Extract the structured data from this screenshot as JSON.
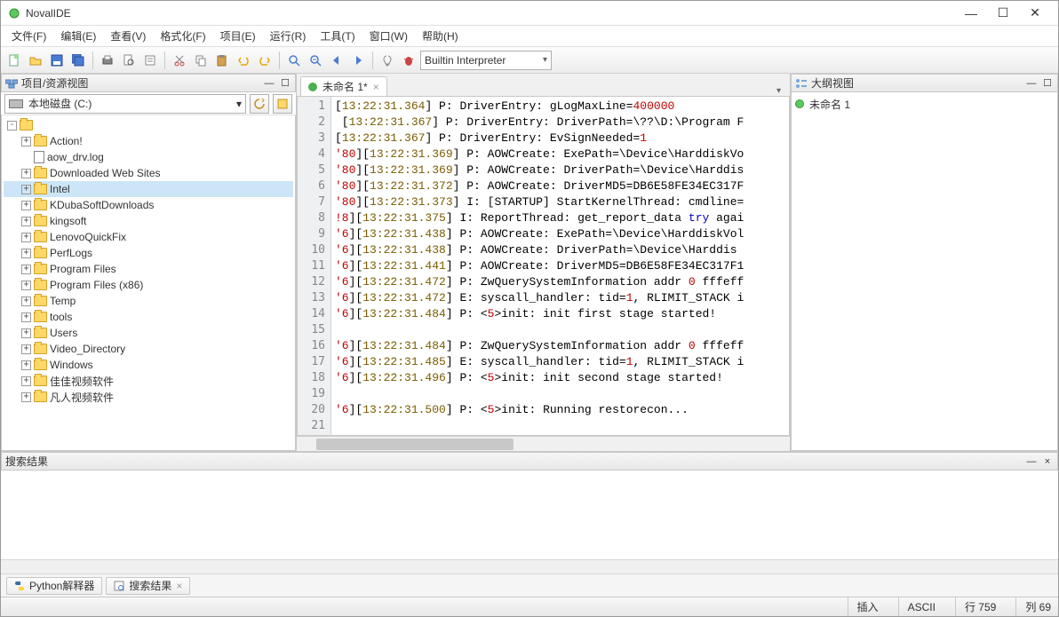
{
  "app": {
    "title": "NovalIDE"
  },
  "menu": [
    "文件(F)",
    "编辑(E)",
    "查看(V)",
    "格式化(F)",
    "项目(E)",
    "运行(R)",
    "工具(T)",
    "窗口(W)",
    "帮助(H)"
  ],
  "toolbar": {
    "interpreter": "Builtin Interpreter"
  },
  "projectPanel": {
    "title": "项目/资源视图",
    "drive": "本地磁盘 (C:)",
    "tree": [
      {
        "exp": "-",
        "ico": "folder",
        "label": ""
      },
      {
        "exp": "+",
        "ico": "folder",
        "label": "Action!",
        "lvl": 1
      },
      {
        "exp": "",
        "ico": "file",
        "label": "aow_drv.log",
        "lvl": 1
      },
      {
        "exp": "+",
        "ico": "folder",
        "label": "Downloaded Web Sites",
        "lvl": 1
      },
      {
        "exp": "+",
        "ico": "folder",
        "label": "Intel",
        "lvl": 1,
        "sel": true
      },
      {
        "exp": "+",
        "ico": "folder",
        "label": "KDubaSoftDownloads",
        "lvl": 1
      },
      {
        "exp": "+",
        "ico": "folder",
        "label": "kingsoft",
        "lvl": 1
      },
      {
        "exp": "+",
        "ico": "folder",
        "label": "LenovoQuickFix",
        "lvl": 1
      },
      {
        "exp": "+",
        "ico": "folder",
        "label": "PerfLogs",
        "lvl": 1
      },
      {
        "exp": "+",
        "ico": "folder",
        "label": "Program Files",
        "lvl": 1
      },
      {
        "exp": "+",
        "ico": "folder",
        "label": "Program Files (x86)",
        "lvl": 1
      },
      {
        "exp": "+",
        "ico": "folder",
        "label": "Temp",
        "lvl": 1
      },
      {
        "exp": "+",
        "ico": "folder",
        "label": "tools",
        "lvl": 1
      },
      {
        "exp": "+",
        "ico": "folder",
        "label": "Users",
        "lvl": 1
      },
      {
        "exp": "+",
        "ico": "folder",
        "label": "Video_Directory",
        "lvl": 1
      },
      {
        "exp": "+",
        "ico": "folder",
        "label": "Windows",
        "lvl": 1
      },
      {
        "exp": "+",
        "ico": "folder",
        "label": "佳佳视频软件",
        "lvl": 1
      },
      {
        "exp": "+",
        "ico": "folder",
        "label": "凡人视频软件",
        "lvl": 1
      }
    ]
  },
  "outlinePanel": {
    "title": "大纲视图",
    "item": "未命名 1"
  },
  "editor": {
    "tab": "未命名 1*",
    "lines": [
      {
        "n": 1,
        "seg": [
          {
            "t": "[",
            "c": ""
          },
          {
            "t": "13:22:31.364",
            "c": "time"
          },
          {
            "t": "] P: DriverEntry: gLogMaxLine=",
            "c": ""
          },
          {
            "t": "400000",
            "c": "num"
          }
        ]
      },
      {
        "n": 2,
        "seg": [
          {
            "t": " [",
            "c": ""
          },
          {
            "t": "13:22:31.367",
            "c": "time"
          },
          {
            "t": "] P: DriverEntry: DriverPath=\\??\\D:\\Program F",
            "c": ""
          }
        ]
      },
      {
        "n": 3,
        "seg": [
          {
            "t": "[",
            "c": ""
          },
          {
            "t": "13:22:31.367",
            "c": "time"
          },
          {
            "t": "] P: DriverEntry: EvSignNeeded=",
            "c": ""
          },
          {
            "t": "1",
            "c": "num"
          }
        ]
      },
      {
        "n": 4,
        "seg": [
          {
            "t": "'80",
            "c": "num"
          },
          {
            "t": "][",
            "c": ""
          },
          {
            "t": "13:22:31.369",
            "c": "time"
          },
          {
            "t": "] P: AOWCreate: ExePath=\\Device\\HarddiskVo",
            "c": ""
          }
        ]
      },
      {
        "n": 5,
        "seg": [
          {
            "t": "'80",
            "c": "num"
          },
          {
            "t": "][",
            "c": ""
          },
          {
            "t": "13:22:31.369",
            "c": "time"
          },
          {
            "t": "] P: AOWCreate: DriverPath=\\Device\\Harddis",
            "c": ""
          }
        ]
      },
      {
        "n": 6,
        "seg": [
          {
            "t": "'80",
            "c": "num"
          },
          {
            "t": "][",
            "c": ""
          },
          {
            "t": "13:22:31.372",
            "c": "time"
          },
          {
            "t": "] P: AOWCreate: DriverMD5=DB6E58FE34EC317F",
            "c": ""
          }
        ]
      },
      {
        "n": 7,
        "seg": [
          {
            "t": "'80",
            "c": "num"
          },
          {
            "t": "][",
            "c": ""
          },
          {
            "t": "13:22:31.373",
            "c": "time"
          },
          {
            "t": "] I: [STARTUP] StartKernelThread: cmdline=",
            "c": ""
          }
        ]
      },
      {
        "n": 8,
        "seg": [
          {
            "t": "!8",
            "c": "num"
          },
          {
            "t": "][",
            "c": ""
          },
          {
            "t": "13:22:31.375",
            "c": "time"
          },
          {
            "t": "] I: ReportThread: get_report_data ",
            "c": ""
          },
          {
            "t": "try",
            "c": "key"
          },
          {
            "t": " agai",
            "c": ""
          }
        ]
      },
      {
        "n": 9,
        "seg": [
          {
            "t": "'6",
            "c": "num"
          },
          {
            "t": "][",
            "c": ""
          },
          {
            "t": "13:22:31.438",
            "c": "time"
          },
          {
            "t": "] P: AOWCreate: ExePath=\\Device\\HarddiskVol",
            "c": ""
          }
        ]
      },
      {
        "n": 10,
        "seg": [
          {
            "t": "'6",
            "c": "num"
          },
          {
            "t": "][",
            "c": ""
          },
          {
            "t": "13:22:31.438",
            "c": "time"
          },
          {
            "t": "] P: AOWCreate: DriverPath=\\Device\\Harddis",
            "c": ""
          }
        ]
      },
      {
        "n": 11,
        "seg": [
          {
            "t": "'6",
            "c": "num"
          },
          {
            "t": "][",
            "c": ""
          },
          {
            "t": "13:22:31.441",
            "c": "time"
          },
          {
            "t": "] P: AOWCreate: DriverMD5=DB6E58FE34EC317F1",
            "c": ""
          }
        ]
      },
      {
        "n": 12,
        "seg": [
          {
            "t": "'6",
            "c": "num"
          },
          {
            "t": "][",
            "c": ""
          },
          {
            "t": "13:22:31.472",
            "c": "time"
          },
          {
            "t": "] P: ZwQuerySystemInformation addr ",
            "c": ""
          },
          {
            "t": "0",
            "c": "num"
          },
          {
            "t": " fffeff",
            "c": ""
          }
        ]
      },
      {
        "n": 13,
        "seg": [
          {
            "t": "'6",
            "c": "num"
          },
          {
            "t": "][",
            "c": ""
          },
          {
            "t": "13:22:31.472",
            "c": "time"
          },
          {
            "t": "] E: syscall_handler: tid=",
            "c": ""
          },
          {
            "t": "1",
            "c": "num"
          },
          {
            "t": ", RLIMIT_STACK i",
            "c": ""
          }
        ]
      },
      {
        "n": 14,
        "seg": [
          {
            "t": "'6",
            "c": "num"
          },
          {
            "t": "][",
            "c": ""
          },
          {
            "t": "13:22:31.484",
            "c": "time"
          },
          {
            "t": "] P: <",
            "c": ""
          },
          {
            "t": "5",
            "c": "num"
          },
          {
            "t": ">init: init first stage started!",
            "c": ""
          }
        ]
      },
      {
        "n": 15,
        "seg": []
      },
      {
        "n": 16,
        "seg": [
          {
            "t": "'6",
            "c": "num"
          },
          {
            "t": "][",
            "c": ""
          },
          {
            "t": "13:22:31.484",
            "c": "time"
          },
          {
            "t": "] P: ZwQuerySystemInformation addr ",
            "c": ""
          },
          {
            "t": "0",
            "c": "num"
          },
          {
            "t": " fffeff",
            "c": ""
          }
        ]
      },
      {
        "n": 17,
        "seg": [
          {
            "t": "'6",
            "c": "num"
          },
          {
            "t": "][",
            "c": ""
          },
          {
            "t": "13:22:31.485",
            "c": "time"
          },
          {
            "t": "] E: syscall_handler: tid=",
            "c": ""
          },
          {
            "t": "1",
            "c": "num"
          },
          {
            "t": ", RLIMIT_STACK i",
            "c": ""
          }
        ]
      },
      {
        "n": 18,
        "seg": [
          {
            "t": "'6",
            "c": "num"
          },
          {
            "t": "][",
            "c": ""
          },
          {
            "t": "13:22:31.496",
            "c": "time"
          },
          {
            "t": "] P: <",
            "c": ""
          },
          {
            "t": "5",
            "c": "num"
          },
          {
            "t": ">init: init second stage started!",
            "c": ""
          }
        ]
      },
      {
        "n": 19,
        "seg": []
      },
      {
        "n": 20,
        "seg": [
          {
            "t": "'6",
            "c": "num"
          },
          {
            "t": "][",
            "c": ""
          },
          {
            "t": "13:22:31.500",
            "c": "time"
          },
          {
            "t": "] P: <",
            "c": ""
          },
          {
            "t": "5",
            "c": "num"
          },
          {
            "t": ">init: Running restorecon...",
            "c": ""
          }
        ]
      },
      {
        "n": 21,
        "seg": []
      }
    ]
  },
  "searchPanel": {
    "title": "搜索结果"
  },
  "bottomTabs": {
    "python": "Python解释器",
    "search": "搜索结果"
  },
  "status": {
    "insert": "插入",
    "encoding": "ASCII",
    "line": "行 759",
    "col": "列 69"
  }
}
